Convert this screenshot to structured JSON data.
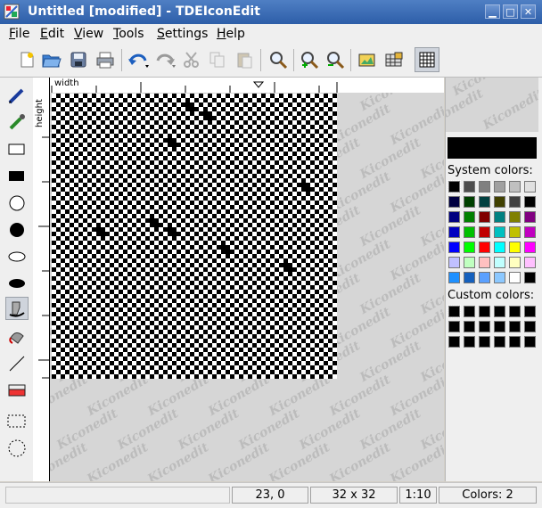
{
  "window": {
    "title": "Untitled [modified] - TDEIconEdit"
  },
  "window_buttons": [
    "minimize",
    "maximize",
    "close"
  ],
  "menubar": [
    {
      "label": "File",
      "accel": "F"
    },
    {
      "label": "Edit",
      "accel": "E"
    },
    {
      "label": "View",
      "accel": "V"
    },
    {
      "label": "Tools",
      "accel": "T"
    },
    {
      "label": "Settings",
      "accel": "S"
    },
    {
      "label": "Help",
      "accel": "H"
    }
  ],
  "toolbar": [
    "new-icon",
    "open-icon",
    "save-icon",
    "print-icon",
    "undo-icon",
    "redo-icon",
    "cut-icon",
    "copy-icon",
    "paste-icon",
    "zoom-icon",
    "zoom-in-icon",
    "zoom-out-icon",
    "image-icon",
    "grid-icon",
    "grid-toggle-icon"
  ],
  "tools": [
    "freehand-icon",
    "eyedropper-icon",
    "rect-outline-icon",
    "rect-filled-icon",
    "circle-outline-icon",
    "circle-filled-icon",
    "ellipse-outline-icon",
    "ellipse-filled-icon",
    "spray-icon",
    "fill-icon",
    "line-icon",
    "eraser-icon",
    "rect-select-icon",
    "circle-select-icon"
  ],
  "rulers": {
    "top_label": "width",
    "left_label": "height"
  },
  "canvas": {
    "watermark": "Kiconedit",
    "pixels": [
      [
        15,
        1
      ],
      [
        17,
        2
      ],
      [
        13,
        5
      ],
      [
        28,
        10
      ],
      [
        11,
        14
      ],
      [
        5,
        15
      ],
      [
        13,
        15
      ],
      [
        19,
        17
      ],
      [
        26,
        19
      ]
    ]
  },
  "panel": {
    "system_colors_label": "System colors:",
    "custom_colors_label": "Custom colors:",
    "current_color": "#000000",
    "system_colors": [
      "#000000",
      "#4d4d4d",
      "#808080",
      "#a0a0a0",
      "#c0c0c0",
      "#e0e0e0",
      "#000040",
      "#004000",
      "#004040",
      "#404000",
      "#404040",
      "#000000",
      "#000080",
      "#008000",
      "#800000",
      "#008080",
      "#808000",
      "#800080",
      "#0000c0",
      "#00c000",
      "#c00000",
      "#00c0c0",
      "#c0c000",
      "#c000c0",
      "#0000ff",
      "#00ff00",
      "#ff0000",
      "#00ffff",
      "#ffff00",
      "#ff00ff",
      "#c0c0ff",
      "#c0ffc0",
      "#ffc0c0",
      "#c0ffff",
      "#ffffc0",
      "#ffc0ff",
      "#1e90ff",
      "#1560bd",
      "#5aa0ff",
      "#8cc8ff",
      "#ffffff",
      "#000000"
    ],
    "custom_colors": [
      "#000000",
      "#000000",
      "#000000",
      "#000000",
      "#000000",
      "#000000",
      "#000000",
      "#000000",
      "#000000",
      "#000000",
      "#000000",
      "#000000",
      "#000000",
      "#000000",
      "#000000",
      "#000000",
      "#000000",
      "#000000"
    ]
  },
  "status": {
    "message": "",
    "coords": "23, 0",
    "size": "32 x 32",
    "zoom": "1:10",
    "colors": "Colors: 2"
  }
}
